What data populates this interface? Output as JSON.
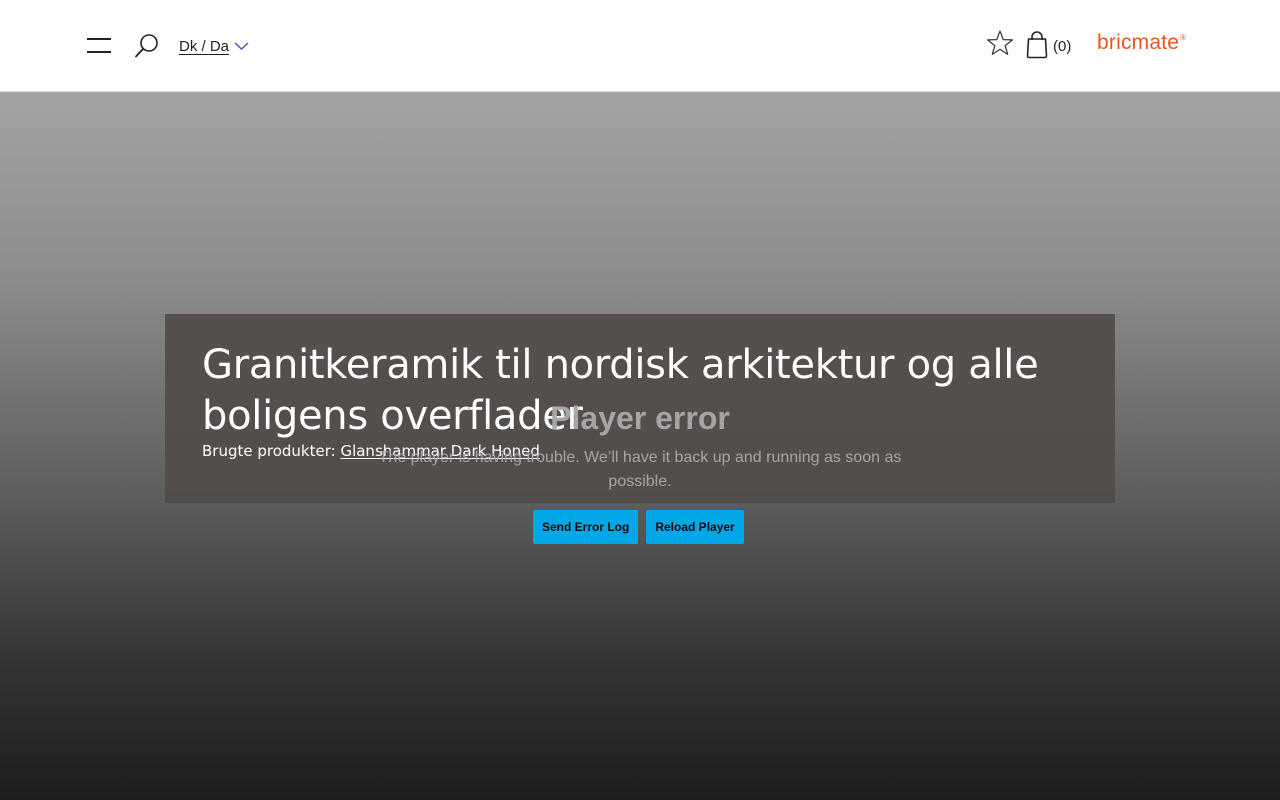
{
  "header": {
    "language": "Dk / Da",
    "cart_count": "(0)",
    "logo_text": "bricmate",
    "logo_mark": "®",
    "icons": {
      "menu": "hamburger-icon",
      "search": "search-icon",
      "language_chevron": "chevron-down-icon",
      "favorites": "star-icon",
      "cart": "shopping-bag-icon"
    },
    "colors": {
      "brand": "#e8571f",
      "text": "#222222",
      "chevron": "#3b5db0"
    }
  },
  "hero": {
    "title": "Granitkeramik til nordisk arkitektur og alle boligens overflader",
    "products_label": "Brugte produkter: ",
    "product_link": "Glanshammar Dark Honed"
  },
  "player": {
    "error_title": "Player error",
    "error_message": "The player is having trouble. We’ll have it back up and running as soon as possible.",
    "send_log_label": "Send Error Log",
    "reload_label": "Reload Player",
    "button_color": "#00a8e8"
  }
}
